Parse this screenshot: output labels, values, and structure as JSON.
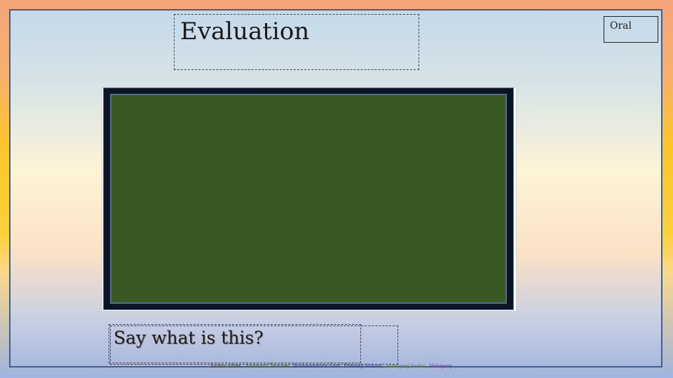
{
  "slide": {
    "title": "Evaluation",
    "tag": "Oral",
    "question": "Say what is this?",
    "footer": {
      "name": "Salma Akter,",
      "role": "Assistant Teacher,",
      "school": "Brahmandora Govt. Primary School,",
      "place": "Habiganj Sadar,",
      "district": "Habiganj"
    }
  },
  "colors": {
    "board_surface": "#3a5824",
    "board_frame": "#0b1424"
  }
}
